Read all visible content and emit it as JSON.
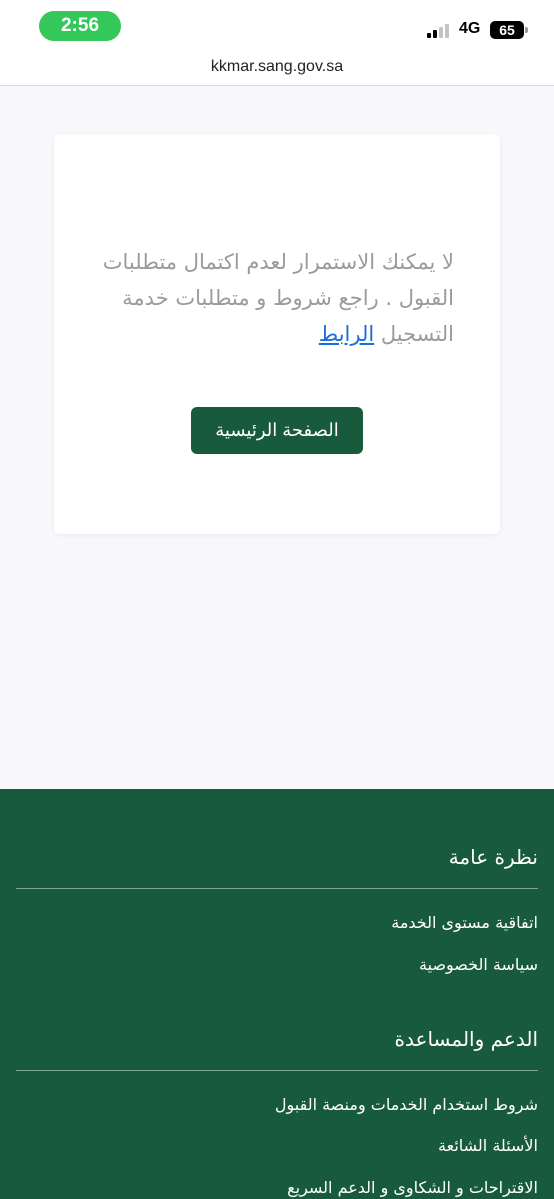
{
  "status_bar": {
    "time": "2:56",
    "network": "4G",
    "battery": "65",
    "time_pill_color": "#34c759"
  },
  "browser": {
    "url": "kkmar.sang.gov.sa"
  },
  "card": {
    "message": "لا يمكنك الاستمرار لعدم اكتمال متطلبات القبول . راجع شروط و متطلبات خدمة التسجيل",
    "link_text": "الرابط",
    "home_button": "الصفحة الرئيسية"
  },
  "footer": {
    "background": "#185b3c",
    "overview": {
      "title": "نظرة عامة",
      "links": [
        "اتفاقية مستوى الخدمة",
        "سياسة الخصوصية"
      ]
    },
    "support": {
      "title": "الدعم والمساعدة",
      "links": [
        "شروط استخدام الخدمات ومنصة القبول",
        "الأسئلة الشائعة",
        "الاقتراحات و الشكاوى و الدعم السريع"
      ]
    }
  }
}
